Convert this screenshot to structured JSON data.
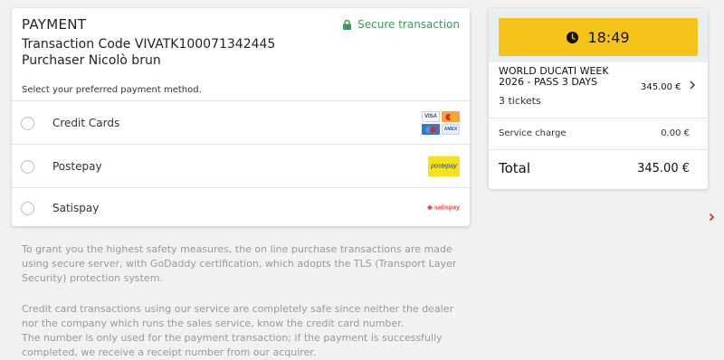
{
  "payment": {
    "title": "PAYMENT",
    "secure_label": "Secure transaction",
    "transaction_code_line": "Transaction Code VIVATK100071342445",
    "purchaser_line": "Purchaser Nicolò brun",
    "select_prompt": "Select your preferred payment method.",
    "methods": [
      {
        "label": "Credit Cards",
        "icon": "credit-cards-logo",
        "selected": false
      },
      {
        "label": "Postepay",
        "icon": "postepay-logo",
        "selected": false
      },
      {
        "label": "Satispay",
        "icon": "satispay-logo",
        "selected": false
      }
    ],
    "logo_text": {
      "visa": "VISA",
      "amex": "AMEX",
      "postepay": "postepay",
      "satispay": "satispay"
    }
  },
  "info": {
    "paragraph1": "To grant you the highest safety measures, the on line purchase transactions are made using secure server, with GoDaddy certification, which adopts the TLS (Transport Layer Security) protection system.",
    "paragraph2_line1": "Credit card transactions using our service are completely safe since neither the dealer nor the company which runs the sales service, know the credit card number.",
    "paragraph2_line2": "The number is only used for the payment transaction; if the payment is successfully completed, we receive a receipt number from our acquirer."
  },
  "summary": {
    "timer": "18:49",
    "event_name": "WORLD DUCATI WEEK 2026 - PASS 3 DAYS",
    "event_price": "345.00 €",
    "tickets": "3 tickets",
    "service_charge_label": "Service charge",
    "service_charge_value": "0.00 €",
    "total_label": "Total",
    "total_value": "345.00 €"
  },
  "colors": {
    "secure_green": "#3a9a55",
    "timer_yellow": "#f5c31a",
    "arrow_red": "#e02020"
  }
}
